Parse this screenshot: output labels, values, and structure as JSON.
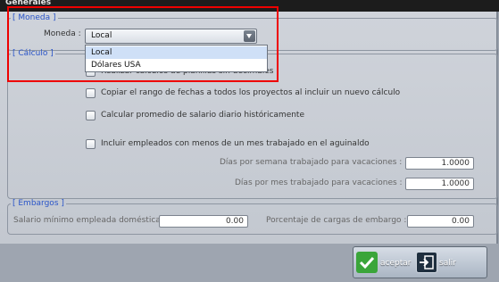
{
  "window": {
    "title": "Generales"
  },
  "moneda": {
    "legend": "[ Moneda ]",
    "label": "Moneda :",
    "selected": "Local",
    "options": [
      "Local",
      "Dólares USA"
    ]
  },
  "calculo": {
    "legend": "[ Cálculo ]",
    "hidden_option_partial": "Realizar cálculos de planillas sin decimales",
    "options": [
      "Copiar el rango de fechas a todos los proyectos al incluir un nuevo cálculo",
      "Calcular promedio de salario diario históricamente",
      "Incluir empleados con menos de un mes trabajado en el aguinaldo"
    ],
    "dias_semana_label": "Días por semana trabajado para vacaciones :",
    "dias_semana_value": "1.0000",
    "dias_mes_label": "Días por mes trabajado para vacaciones :",
    "dias_mes_value": "1.0000"
  },
  "embargos": {
    "legend": "[ Embargos ]",
    "salario_label": "Salario mínimo empleada doméstica",
    "salario_value": "0.00",
    "porcentaje_label": "Porcentaje de cargas de embargo :",
    "porcentaje_value": "0.00"
  },
  "buttons": {
    "accept": "aceptar",
    "exit": "salir"
  },
  "colors": {
    "legend": "#2a55c8",
    "highlight": "#ee0000",
    "accept_icon": "#3aa53a"
  },
  "icons": {
    "accept": "check-icon",
    "exit": "exit-icon",
    "dropdown": "chevron-down-icon"
  }
}
